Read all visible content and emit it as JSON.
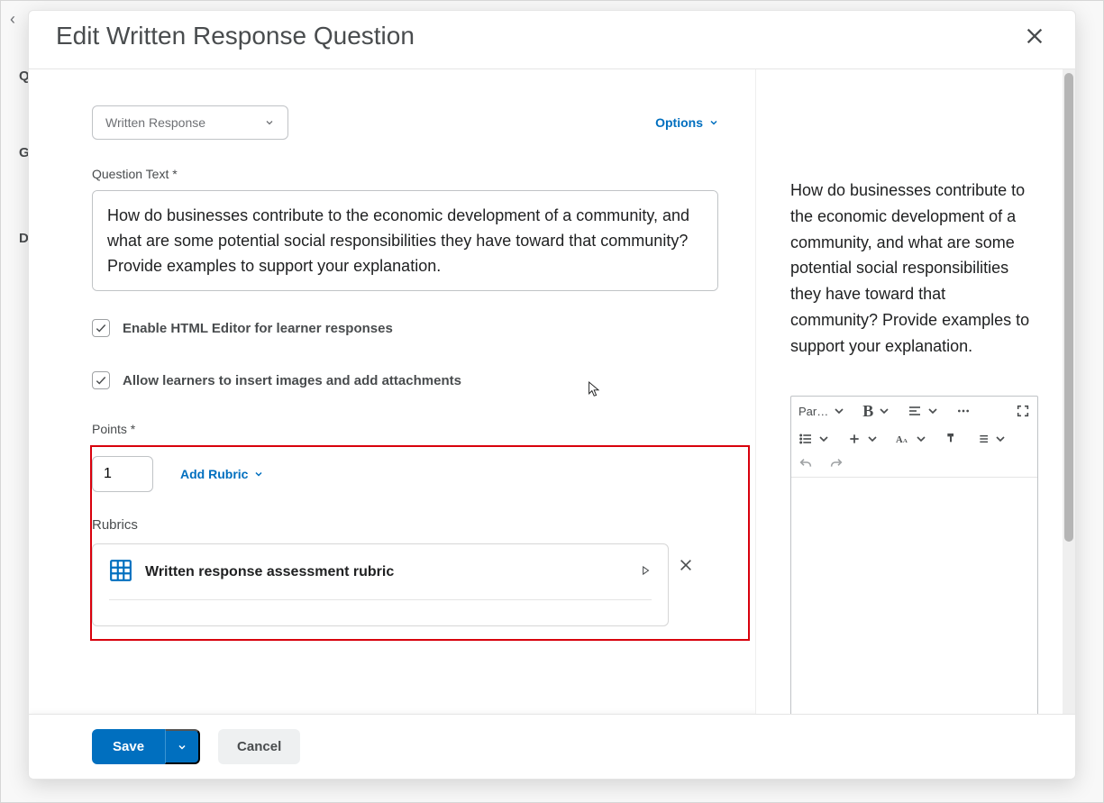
{
  "header": {
    "title": "Edit Written Response Question"
  },
  "editor": {
    "typeSelect": {
      "label": "Written Response"
    },
    "optionsLabel": "Options",
    "questionTextLabel": "Question Text *",
    "questionText": "How do businesses contribute to the economic development of a community, and what are some potential social responsibilities they have toward that community? Provide examples to support your explanation.",
    "enableHtml": {
      "checked": true,
      "label": "Enable HTML Editor for learner responses"
    },
    "allowAttachments": {
      "checked": true,
      "label": "Allow learners to insert images and add attachments"
    },
    "pointsLabel": "Points *",
    "pointsValue": "1",
    "addRubricLabel": "Add Rubric",
    "rubricsLabel": "Rubrics",
    "rubric": {
      "title": "Written response assessment rubric"
    }
  },
  "preview": {
    "text": "How do businesses contribute to the economic development of a community, and what are some potential social responsibilities they have toward that community? Provide examples to support your explanation.",
    "toolbar": {
      "paragraph": "Par…"
    }
  },
  "footer": {
    "save": "Save",
    "cancel": "Cancel"
  },
  "background": {
    "back_chevron": "‹",
    "q": "Q",
    "g": "G",
    "d": "D"
  }
}
